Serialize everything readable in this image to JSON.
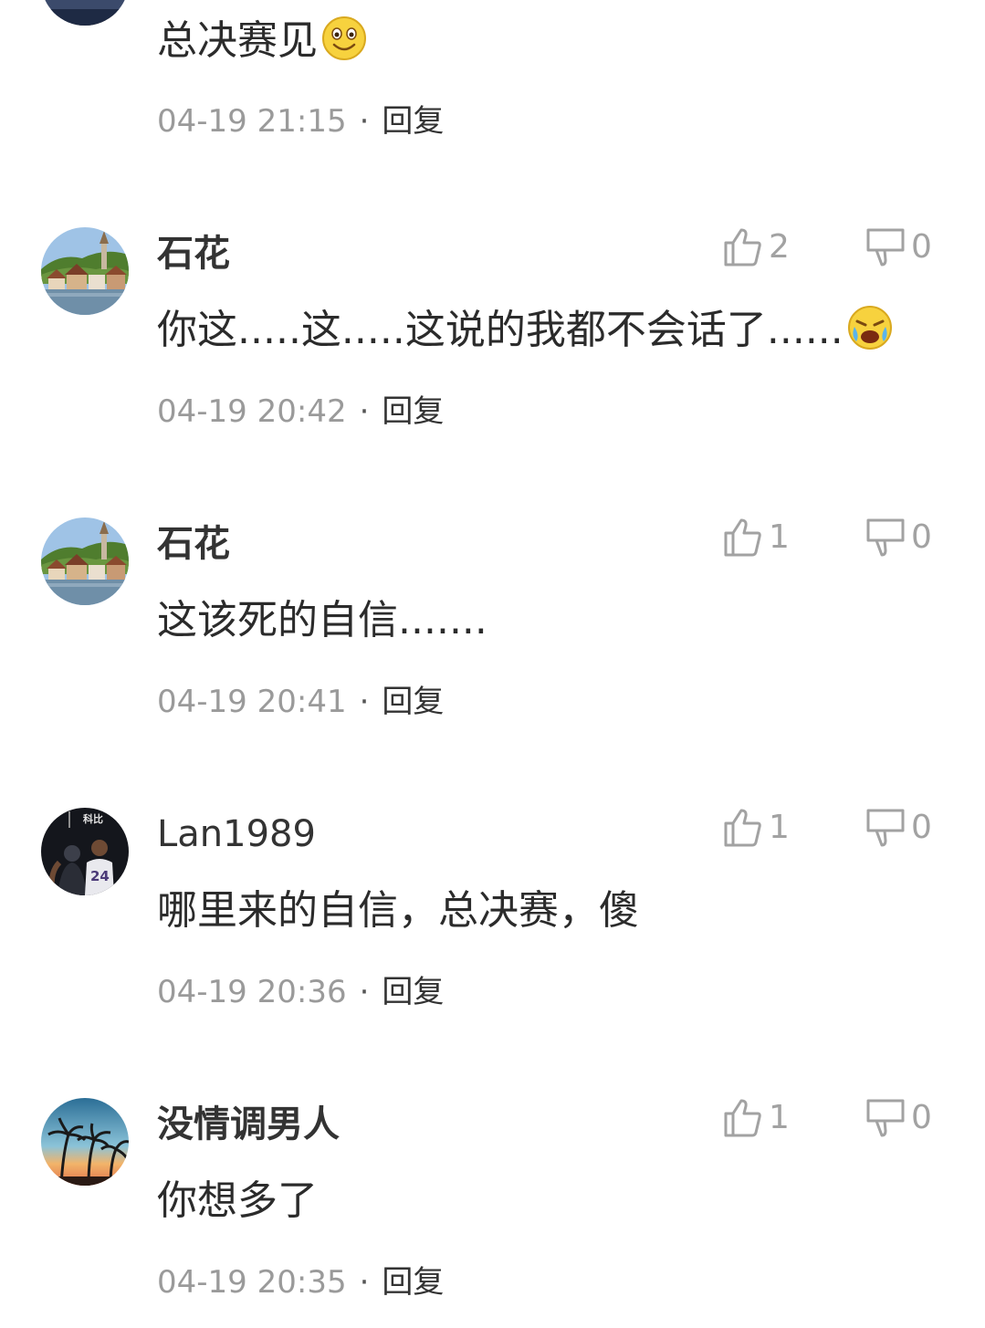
{
  "top_comment": {
    "text": "总决赛见",
    "emoji_icon": "smile-emoji",
    "time": "04-19 21:15",
    "separator": "·",
    "reply_label": "回复"
  },
  "comments": [
    {
      "username": "石花",
      "text": "你这.....这.....这说的我都不会话了......",
      "emoji_icon": "crying-emoji",
      "likes": "2",
      "dislikes": "0",
      "time": "04-19 20:42",
      "separator": "·",
      "reply_label": "回复",
      "avatar_icon": "landscape-avatar"
    },
    {
      "username": "石花",
      "text": "这该死的自信.......",
      "likes": "1",
      "dislikes": "0",
      "time": "04-19 20:41",
      "separator": "·",
      "reply_label": "回复",
      "avatar_icon": "landscape-avatar"
    },
    {
      "username": "Lan1989",
      "text": "哪里来的自信，总决赛，傻",
      "likes": "1",
      "dislikes": "0",
      "time": "04-19 20:36",
      "separator": "·",
      "reply_label": "回复",
      "avatar_icon": "basketball-player-avatar",
      "avatar_text": "科比",
      "avatar_number": "24"
    },
    {
      "username": "没情调男人",
      "text": "你想多了",
      "likes": "1",
      "dislikes": "0",
      "time": "04-19 20:35",
      "separator": "·",
      "reply_label": "回复",
      "avatar_icon": "palm-sunset-avatar"
    }
  ],
  "colors": {
    "text": "#2b2b2b",
    "username": "#333333",
    "meta": "#9a9a9a",
    "vote": "#a2a2a2"
  }
}
